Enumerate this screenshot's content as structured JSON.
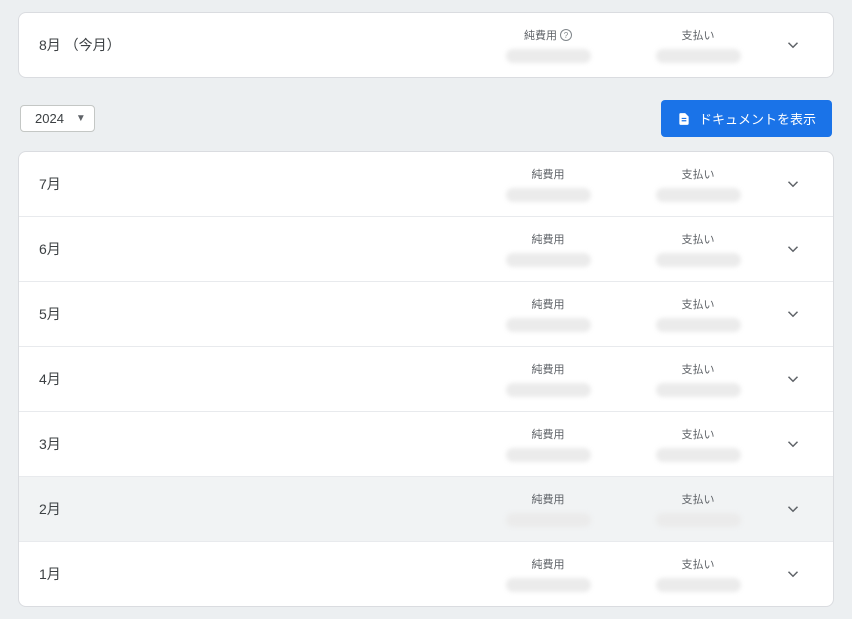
{
  "currentMonth": {
    "label": "8月 （今月）",
    "costLabel": "純費用",
    "paymentLabel": "支払い",
    "hasHelp": true
  },
  "toolbar": {
    "yearSelected": "2024",
    "docButtonLabel": "ドキュメントを表示"
  },
  "rows": [
    {
      "label": "7月",
      "costLabel": "純費用",
      "paymentLabel": "支払い",
      "highlight": false
    },
    {
      "label": "6月",
      "costLabel": "純費用",
      "paymentLabel": "支払い",
      "highlight": false
    },
    {
      "label": "5月",
      "costLabel": "純費用",
      "paymentLabel": "支払い",
      "highlight": false
    },
    {
      "label": "4月",
      "costLabel": "純費用",
      "paymentLabel": "支払い",
      "highlight": false
    },
    {
      "label": "3月",
      "costLabel": "純費用",
      "paymentLabel": "支払い",
      "highlight": false
    },
    {
      "label": "2月",
      "costLabel": "純費用",
      "paymentLabel": "支払い",
      "highlight": true
    },
    {
      "label": "1月",
      "costLabel": "純費用",
      "paymentLabel": "支払い",
      "highlight": false
    }
  ]
}
